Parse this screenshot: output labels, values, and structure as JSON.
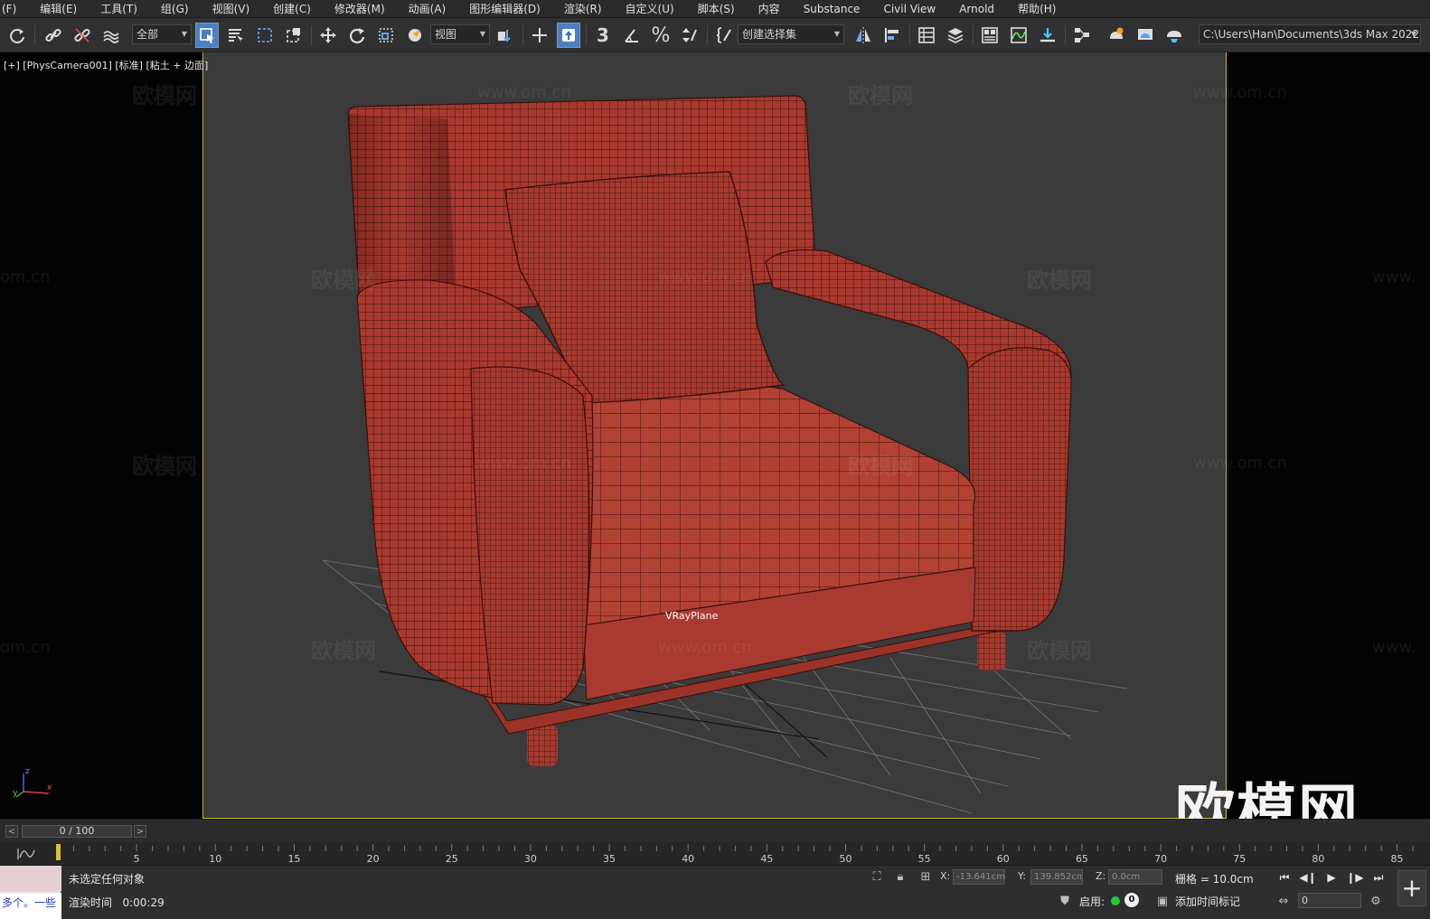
{
  "menu": [
    "(F)",
    "编辑(E)",
    "工具(T)",
    "组(G)",
    "视图(V)",
    "创建(C)",
    "修改器(M)",
    "动画(A)",
    "图形编辑器(D)",
    "渲染(R)",
    "自定义(U)",
    "脚本(S)",
    "内容",
    "Substance",
    "Civil View",
    "Arnold",
    "帮助(H)"
  ],
  "toolbar": {
    "selection_filter": "全部",
    "reference_coord": "视图",
    "named_selection": "创建选择集",
    "project_path": "C:\\Users\\Han\\Documents\\3ds Max 2022",
    "percent_snap_glyph": "%",
    "angle_snap_glyph": "3"
  },
  "viewport": {
    "label": "[+] [PhysCamera001] [标准] [粘土 + 边面]",
    "object_label": "VRayPlane",
    "watermark_text": "欧模网",
    "watermark_url": "www.om.cn",
    "watermark_url_short": "om.cn",
    "watermark_url_partial": "www.",
    "brand": "欧模网",
    "axis_x": "x",
    "axis_y": "y",
    "axis_z": "z"
  },
  "timeslider": {
    "frame_display": "0 / 100",
    "prev": "<",
    "next": ">"
  },
  "timeline": {
    "labels": [
      "5",
      "10",
      "15",
      "20",
      "25",
      "30",
      "35",
      "40",
      "45",
      "50",
      "55",
      "60",
      "65",
      "70",
      "75",
      "80",
      "85"
    ],
    "current_frame": 0,
    "max_frame": 100
  },
  "status": {
    "listener_text": "多个。一些",
    "selection_status": "未选定任何对象",
    "render_time_label": "渲染时间",
    "render_time_value": "0:00:29",
    "x_label": "X:",
    "x_value": "-13.641cm",
    "y_label": "Y:",
    "y_value": "139.852cm",
    "z_label": "Z:",
    "z_value": "0.0cm",
    "grid_label": "栅格 = 10.0cm",
    "enable_label": "启用:",
    "enable_count": "0",
    "add_time_tag": "添加时间标记",
    "frame_value": "0",
    "plus": "+"
  },
  "colors": {
    "camera_frame_border": "#c9b52a",
    "sofa": "#a8392e",
    "active_tool": "#4d7fbf",
    "viewport_bg": "#3b3b3b"
  },
  "icons": [
    "redo-icon",
    "link-icon",
    "unlink-icon",
    "bind-space-warp-icon",
    "select-object-icon",
    "select-by-name-icon",
    "rect-region-icon",
    "window-crossing-icon",
    "move-icon",
    "rotate-icon",
    "scale-icon",
    "select-manipulate-icon",
    "pivot-icon",
    "snap-3d-icon",
    "angle-snap-icon",
    "percent-snap-icon",
    "spinner-snap-icon",
    "edit-named-sets-icon",
    "mirror-icon",
    "align-icon",
    "scene-explorer-icon",
    "layer-icon",
    "ribbon-icon",
    "curve-editor-icon",
    "dope-sheet-icon",
    "schematic-icon",
    "render-setup-icon",
    "render-frame-icon",
    "render-icon"
  ]
}
